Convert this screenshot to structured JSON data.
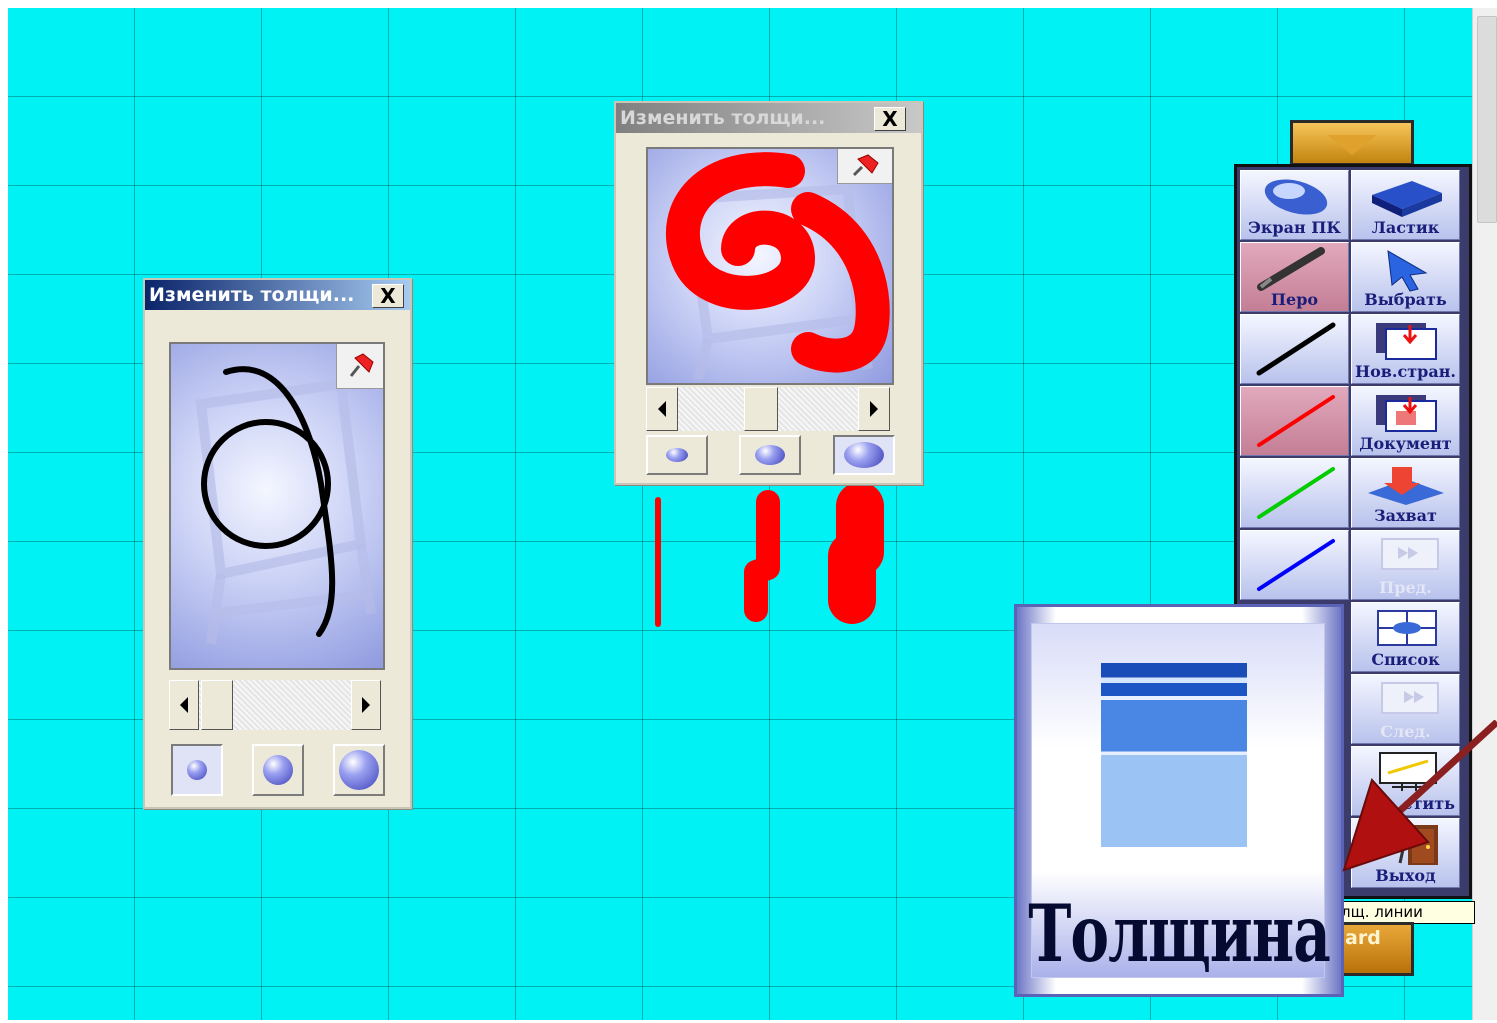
{
  "dialogs": [
    {
      "title": "Изменить толщи...",
      "close_label": "X",
      "state": "active",
      "stroke_color": "#000000",
      "selected_size": "small"
    },
    {
      "title": "Изменить толщи...",
      "close_label": "X",
      "state": "inactive",
      "stroke_color": "#ff0000",
      "selected_size": "large"
    }
  ],
  "toolbar": {
    "buttons": [
      {
        "label": "Экран ПК",
        "icon": "mouse-icon"
      },
      {
        "label": "Ластик",
        "icon": "eraser-icon"
      },
      {
        "label": "Перо",
        "icon": "pen-icon",
        "selected": true
      },
      {
        "label": "Выбрать",
        "icon": "cursor-arrow-icon"
      },
      {
        "label": "",
        "icon": "black-line-icon",
        "color": "#000000"
      },
      {
        "label": "Нов.стран.",
        "icon": "new-page-icon"
      },
      {
        "label": "",
        "icon": "red-line-icon",
        "color": "#ff0000",
        "selected": true
      },
      {
        "label": "Документ",
        "icon": "document-icon"
      },
      {
        "label": "",
        "icon": "green-line-icon",
        "color": "#00cc00"
      },
      {
        "label": "Захват",
        "icon": "capture-icon"
      },
      {
        "label": "",
        "icon": "blue-line-icon",
        "color": "#0000ff"
      },
      {
        "label": "Пред.",
        "icon": "previous-page-icon",
        "disabled": true
      },
      {
        "label": "Список",
        "icon": "list-icon"
      },
      {
        "label": "След.",
        "icon": "next-page-icon",
        "disabled": true
      },
      {
        "label": "стить",
        "icon": "clear-icon"
      },
      {
        "label": "Выход",
        "icon": "exit-door-icon"
      }
    ]
  },
  "tooltip": {
    "text": "лщ. линии"
  },
  "board_button": {
    "label": "ard"
  },
  "zoom_icon": {
    "label": "Толщина"
  },
  "colors": {
    "canvas": "#00f2f4",
    "pointer_arrow": "#8b2020",
    "toolbar_accent": "#e0a22d"
  }
}
